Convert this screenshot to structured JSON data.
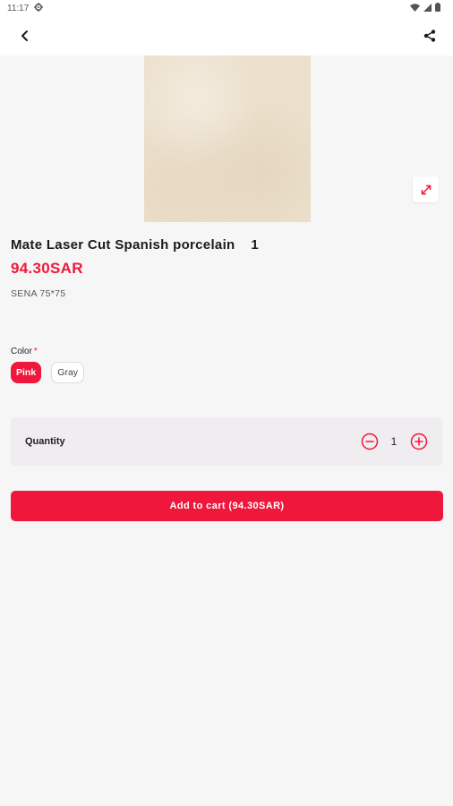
{
  "status_bar": {
    "time": "11:17",
    "icons": [
      "settings-icon",
      "wifi-icon",
      "signal-icon",
      "battery-icon"
    ]
  },
  "app_bar": {
    "icons": [
      "back-arrow-icon",
      "share-icon"
    ]
  },
  "product": {
    "title": "Mate Laser Cut Spanish porcelain    1",
    "price": "94.30SAR",
    "sku": "SENA 75*75",
    "image_icon": "expand-icon"
  },
  "color_option": {
    "label": "Color",
    "required_mark": "*",
    "options": [
      {
        "label": "Pink",
        "selected": true
      },
      {
        "label": "Gray",
        "selected": false
      }
    ]
  },
  "quantity": {
    "label": "Quantity",
    "value": "1",
    "icons": [
      "minus-circle-icon",
      "plus-circle-icon"
    ]
  },
  "cart_button": {
    "label": "Add to cart (94.30SAR)"
  },
  "colors": {
    "accent": "#f0173c",
    "background": "#f6f6f6",
    "quantity_card": "#efedef"
  }
}
